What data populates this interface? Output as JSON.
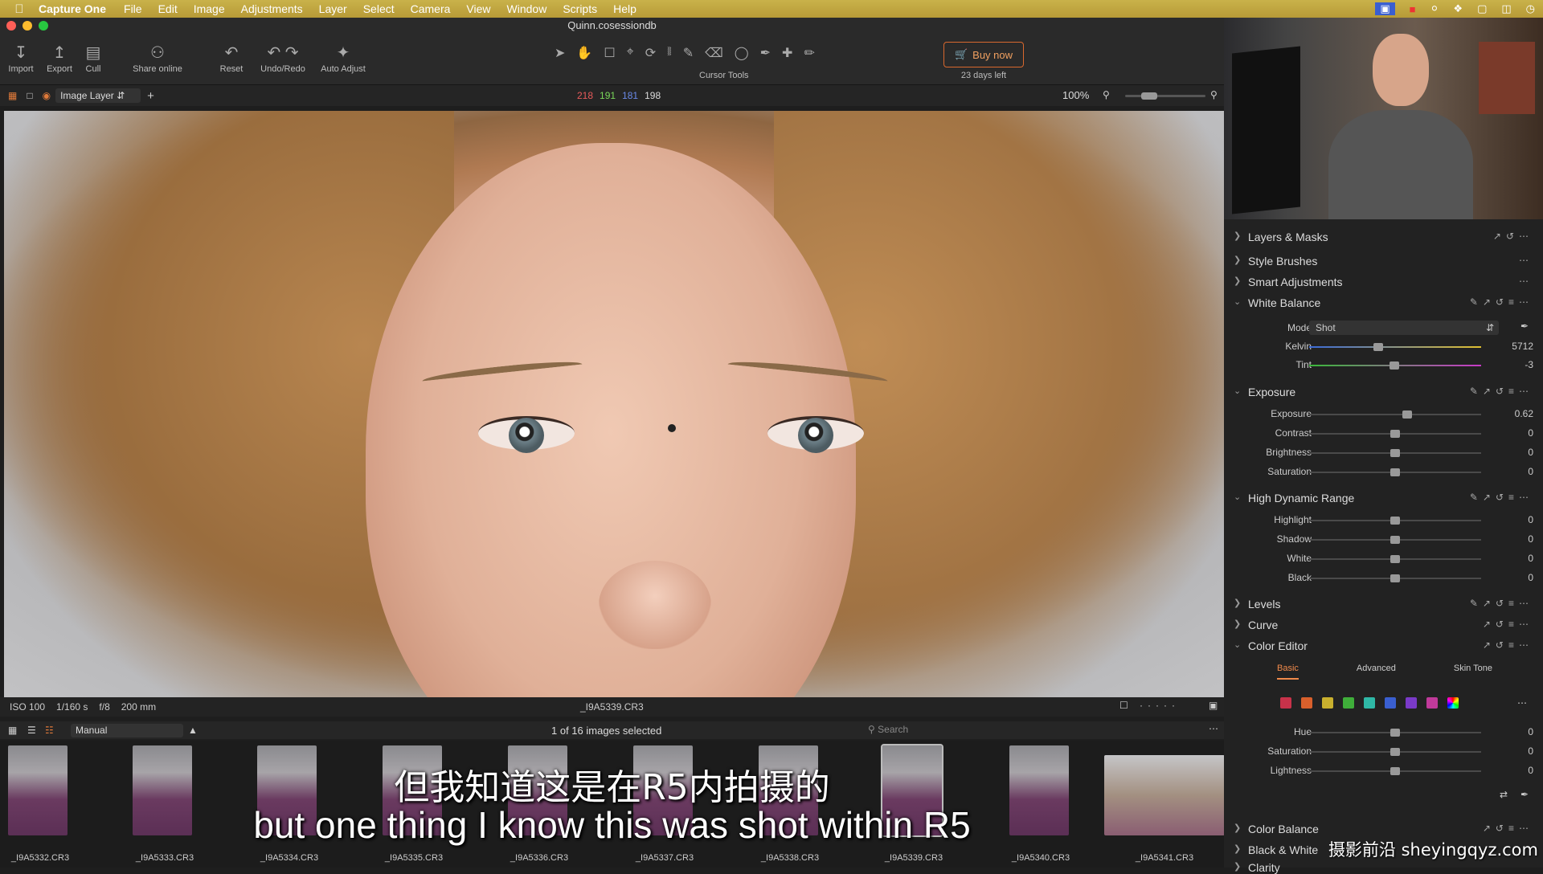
{
  "menubar": {
    "app_name": "Capture One",
    "items": [
      "File",
      "Edit",
      "Image",
      "Adjustments",
      "Layer",
      "Select",
      "Camera",
      "View",
      "Window",
      "Scripts",
      "Help"
    ]
  },
  "window": {
    "title": "Quinn.cosessiondb"
  },
  "toolbar": {
    "import": "Import",
    "export": "Export",
    "cull": "Cull",
    "share": "Share online",
    "reset": "Reset",
    "undo_redo": "Undo/Redo",
    "auto_adjust": "Auto Adjust",
    "cursor_tools": "Cursor Tools",
    "buy_now": "Buy now",
    "trial": "23 days left"
  },
  "viewbar": {
    "layer": "Image Layer",
    "rgb": {
      "r": "218",
      "g": "191",
      "b": "181",
      "l": "198"
    },
    "zoom": "100%"
  },
  "info": {
    "iso": "ISO 100",
    "shutter": "1/160 s",
    "aperture": "f/8",
    "focal": "200 mm",
    "filename": "_I9A5339.CR3"
  },
  "browser": {
    "sort": "Manual",
    "count": "1 of 16 images selected",
    "search_placeholder": "Search",
    "thumbs": [
      "_I9A5332.CR3",
      "_I9A5333.CR3",
      "_I9A5334.CR3",
      "_I9A5335.CR3",
      "_I9A5336.CR3",
      "_I9A5337.CR3",
      "_I9A5338.CR3",
      "_I9A5339.CR3",
      "_I9A5340.CR3",
      "_I9A5341.CR3"
    ]
  },
  "panel": {
    "layers_masks": "Layers & Masks",
    "style_brushes": "Style Brushes",
    "smart_adjustments": "Smart Adjustments",
    "white_balance": {
      "title": "White Balance",
      "mode_label": "Mode",
      "mode_value": "Shot",
      "kelvin_label": "Kelvin",
      "kelvin_value": "5712",
      "tint_label": "Tint",
      "tint_value": "-3"
    },
    "exposure": {
      "title": "Exposure",
      "rows": [
        {
          "label": "Exposure",
          "value": "0.62",
          "pos": 0.57
        },
        {
          "label": "Contrast",
          "value": "0",
          "pos": 0.5
        },
        {
          "label": "Brightness",
          "value": "0",
          "pos": 0.5
        },
        {
          "label": "Saturation",
          "value": "0",
          "pos": 0.5
        }
      ]
    },
    "hdr": {
      "title": "High Dynamic Range",
      "rows": [
        {
          "label": "Highlight",
          "value": "0",
          "pos": 0.5
        },
        {
          "label": "Shadow",
          "value": "0",
          "pos": 0.5
        },
        {
          "label": "White",
          "value": "0",
          "pos": 0.5
        },
        {
          "label": "Black",
          "value": "0",
          "pos": 0.5
        }
      ]
    },
    "levels": "Levels",
    "curve": "Curve",
    "color_editor": {
      "title": "Color Editor",
      "tabs": [
        "Basic",
        "Advanced",
        "Skin Tone"
      ],
      "swatch_colors": [
        "#c8324a",
        "#d9602c",
        "#c9b02e",
        "#3fae3a",
        "#2fb8a6",
        "#3a5fd0",
        "#7a3ac8",
        "#c03a9a"
      ],
      "rows": [
        {
          "label": "Hue",
          "value": "0",
          "pos": 0.5
        },
        {
          "label": "Saturation",
          "value": "0",
          "pos": 0.5
        },
        {
          "label": "Lightness",
          "value": "0",
          "pos": 0.5
        }
      ]
    },
    "color_balance": "Color Balance",
    "black_white": "Black & White",
    "clarity": "Clarity"
  },
  "subtitles": {
    "cn": "但我知道这是在R5内拍摄的",
    "en": "but one thing I know this was shot within R5"
  },
  "watermark": "摄影前沿 sheyingqyz.com"
}
